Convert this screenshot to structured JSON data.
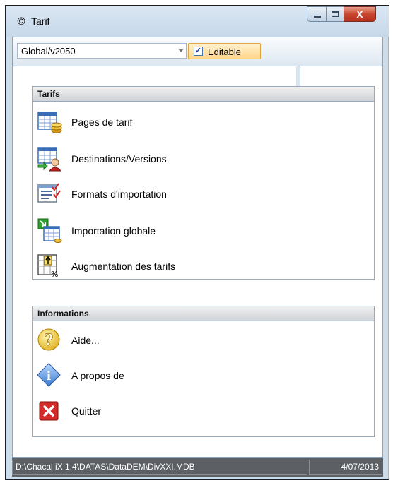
{
  "window": {
    "title": "Tarif",
    "icon": "copyright-icon"
  },
  "controls": {
    "close_glyph": "X"
  },
  "toolbar": {
    "selector_value": "Global/v2050",
    "editable_label": "Editable",
    "editable_checked": true,
    "check_glyph": "✓"
  },
  "groups": {
    "tarifs": {
      "title": "Tarifs",
      "items": [
        {
          "label": "Pages de tarif",
          "icon": "price-pages-icon"
        },
        {
          "label": "Destinations/Versions",
          "icon": "destinations-icon"
        },
        {
          "label": "Formats d'importation",
          "icon": "import-formats-icon"
        },
        {
          "label": "Importation globale",
          "icon": "global-import-icon"
        },
        {
          "label": "Augmentation des tarifs",
          "icon": "price-increase-icon"
        }
      ]
    },
    "informations": {
      "title": "Informations",
      "items": [
        {
          "label": "Aide...",
          "icon": "help-icon"
        },
        {
          "label": "A propos de",
          "icon": "info-icon"
        },
        {
          "label": "Quitter",
          "icon": "exit-icon"
        }
      ]
    }
  },
  "statusbar": {
    "path": "D:\\Chacal iX 1.4\\DATAS\\DataDEM\\DivXXI.MDB",
    "date": "4/07/2013"
  },
  "colors": {
    "accent": "#ffd58a",
    "title_bg": "#c6d8ea",
    "status_bg": "#5c6064"
  }
}
